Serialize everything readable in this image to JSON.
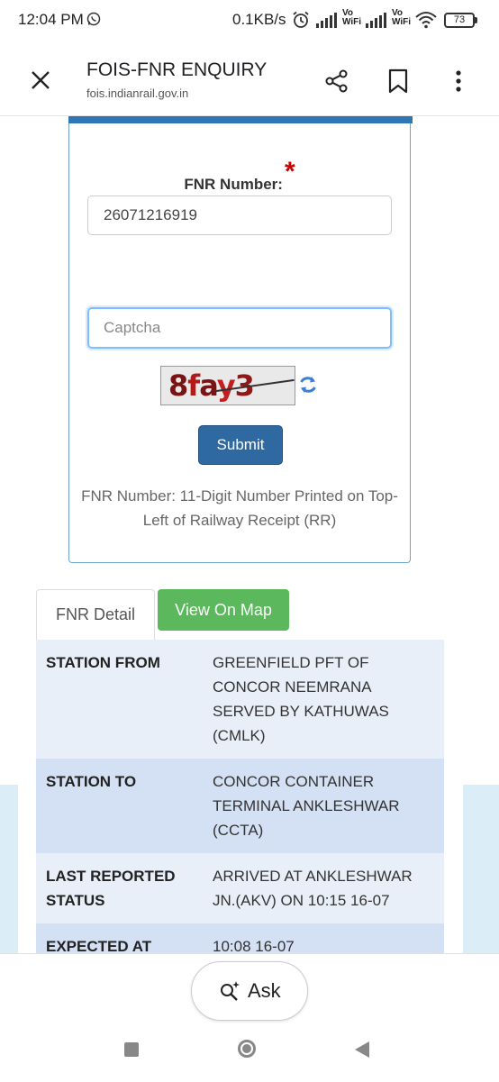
{
  "status_bar": {
    "time": "12:04 PM",
    "network_speed": "0.1KB/s",
    "vo_label": "Vo",
    "wifi_label": "WiFi",
    "battery": "73",
    "icons": [
      "whatsapp-icon",
      "alarm-icon",
      "signal-icon",
      "wifi-icon",
      "battery-icon"
    ]
  },
  "toolbar": {
    "title": "FOIS-FNR ENQUIRY",
    "url": "fois.indianrail.gov.in",
    "icons": [
      "close-icon",
      "share-icon",
      "bookmark-icon",
      "more-vert-icon"
    ]
  },
  "form": {
    "fnr_label": "FNR Number:",
    "required_mark": "*",
    "fnr_value": "26071216919",
    "captcha_placeholder": "Captcha",
    "captcha_text": "8fay3",
    "submit_label": "Submit",
    "hint": "FNR Number: 11-Digit Number Printed on Top-Left of Railway Receipt (RR)"
  },
  "tabs": [
    {
      "label": "FNR Detail",
      "active": true
    },
    {
      "label": "View On Map",
      "active": false
    }
  ],
  "details": [
    {
      "key": "STATION FROM",
      "value": "GREENFIELD PFT OF CONCOR NEEMRANA SERVED BY KATHUWAS (CMLK)"
    },
    {
      "key": "STATION TO",
      "value": "CONCOR CONTAINER TERMINAL ANKLESHWAR (CCTA)"
    },
    {
      "key": "LAST REPORTED STATUS",
      "value": "ARRIVED AT ANKLESHWAR JN.(AKV) ON 10:15 16-07"
    },
    {
      "key": "EXPECTED AT",
      "value": "10:08 16-07"
    }
  ],
  "bottom": {
    "ask_label": "Ask"
  },
  "colors": {
    "primary": "#2e6aa1",
    "success": "#5cb85c",
    "required": "#cc0000",
    "row_odd": "#e9eff9",
    "row_even": "#d4e0f3"
  }
}
